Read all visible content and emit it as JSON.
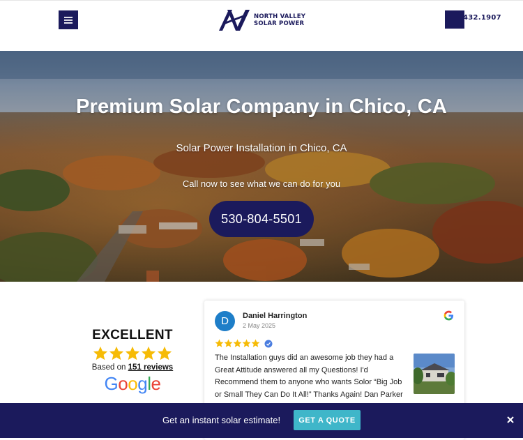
{
  "header": {
    "logo_line1": "NORTH VALLEY",
    "logo_line2": "SOLAR POWER",
    "phone_partial": "432.1907",
    "brand_color": "#1b1a5c"
  },
  "hero": {
    "title": "Premium Solar Company in Chico, CA",
    "subtitle": "Solar Power Installation in Chico, CA",
    "cta_text": "Call now to see what we can do for you",
    "phone_button": "530-804-5501"
  },
  "reviews_summary": {
    "rating_label": "EXCELLENT",
    "stars": 5,
    "based_on_prefix": "Based on",
    "reviews_link": "151 reviews",
    "google": [
      "G",
      "o",
      "o",
      "g",
      "l",
      "e"
    ]
  },
  "review": {
    "avatar_letter": "D",
    "name": "Daniel Harrington",
    "date": "2 May 2025",
    "stars": 5,
    "text": "The Installation guys did an awesome job they had a Great Attitude answered all my Questions! I'd Recommend them to anyone who wants Solor “Big Job or Small They Can Do It All!” Thanks Again! Dan Parker"
  },
  "bottom_bar": {
    "text": "Get an instant solar estimate!",
    "button": "GET A QUOTE",
    "accent": "#3fb6c9"
  },
  "icons": [
    "menu-icon",
    "logo-mark-icon",
    "google-g-icon",
    "verified-icon",
    "close-icon",
    "star-icon"
  ]
}
